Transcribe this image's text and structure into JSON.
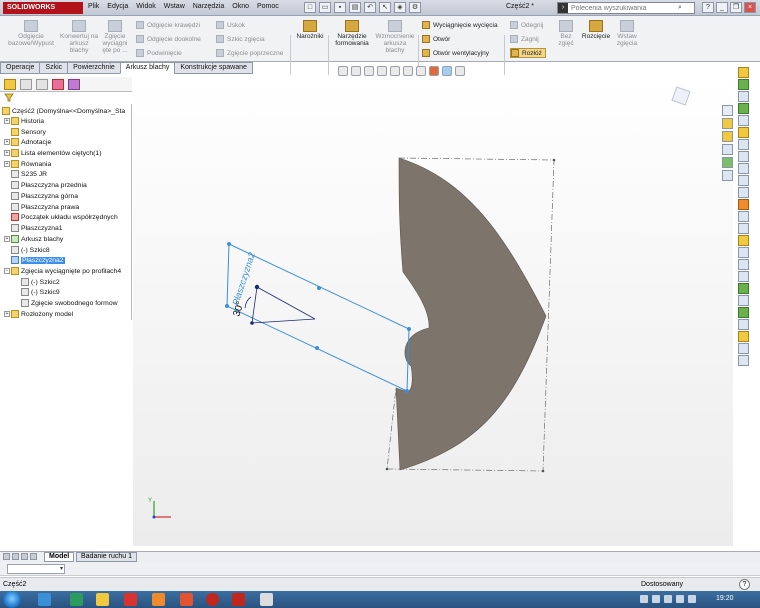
{
  "titlebar": {
    "app_name": "SOLIDWORKS",
    "menu": [
      "Plik",
      "Edycja",
      "Widok",
      "Wstaw",
      "Narzędzia",
      "Okno",
      "Pomoc"
    ],
    "doc_title": "Część2 *",
    "search_placeholder": "Polecenia wyszukiwania"
  },
  "ribbon": {
    "btn_odgiecie": "Odgięcie bazowe/Wypust",
    "btn_konwertuj": "Konwertuj na arkusz blachy",
    "btn_zgiecie": "Zgięcie wyciągni ęte po ...",
    "btn_odgiecie_krawedzi": "Odgięcie krawędzi",
    "btn_odgiecie_dookolne": "Odgięcie dookolne",
    "btn_podwiniecie": "Podwinięcie",
    "btn_uskok": "Uskok",
    "btn_szkic_zgiecia": "Szkic zgięcia",
    "btn_zgiecie_poprzeczne": "Zgięcie poprzeczne",
    "btn_narozniki": "Narożniki",
    "btn_narzedzie_formowania": "Narzędzie formowania",
    "btn_wzmocnienie": "Wzmocnienie arkusza blachy",
    "btn_wyciagniecie": "Wyciągnięcie wycięcia",
    "btn_otwor": "Otwór",
    "btn_otwor_went": "Otwór wentylacyjny",
    "btn_odegnij": "Odegnij",
    "btn_zagnij": "Zagnij",
    "btn_rozloz": "Rozłóż",
    "btn_bez_zgiec": "Bez zgięć",
    "btn_rozcięcie": "Rozcięcie",
    "btn_wstaw_zgiecia": "Wstaw zgięcia"
  },
  "tabs": [
    "Operacje",
    "Szkic",
    "Powierzchnie",
    "Arkusz blachy",
    "Konstrukcje spawane"
  ],
  "tree": {
    "root": "Część2  (Domyślna<<Domyślna>_Sta",
    "items": [
      "Historia",
      "Sensory",
      "Adnotacje",
      "Lista elementów ciętych(1)",
      "Równania",
      "S235 JR",
      "Płaszczyzna przednia",
      "Płaszczyzna górna",
      "Płaszczyzna prawa",
      "Początek układu współrzędnych",
      "Płaszczyzna1",
      "Arkusz blachy",
      "(-) Szkic8",
      "Płaszczyzna2",
      "Zgięcia wyciągnięte po profilach4",
      "(-) Szkic2",
      "(-) Szkic9",
      "Zgięcie swobodnego formow",
      "Rozłożony model"
    ]
  },
  "canvas": {
    "plane_label": "Płaszczyzna2",
    "angle_label": "30°",
    "axis_label": "Y"
  },
  "bottom_tabs": [
    "Model",
    "Badanie ruchu 1"
  ],
  "status": {
    "left": "Część2",
    "right": "Dostosowany",
    "help": "?"
  },
  "clock": "19:20",
  "colors": {
    "accent": "#3d8ee6",
    "brand": "#b3121b",
    "part_fill": "#7d746c"
  }
}
